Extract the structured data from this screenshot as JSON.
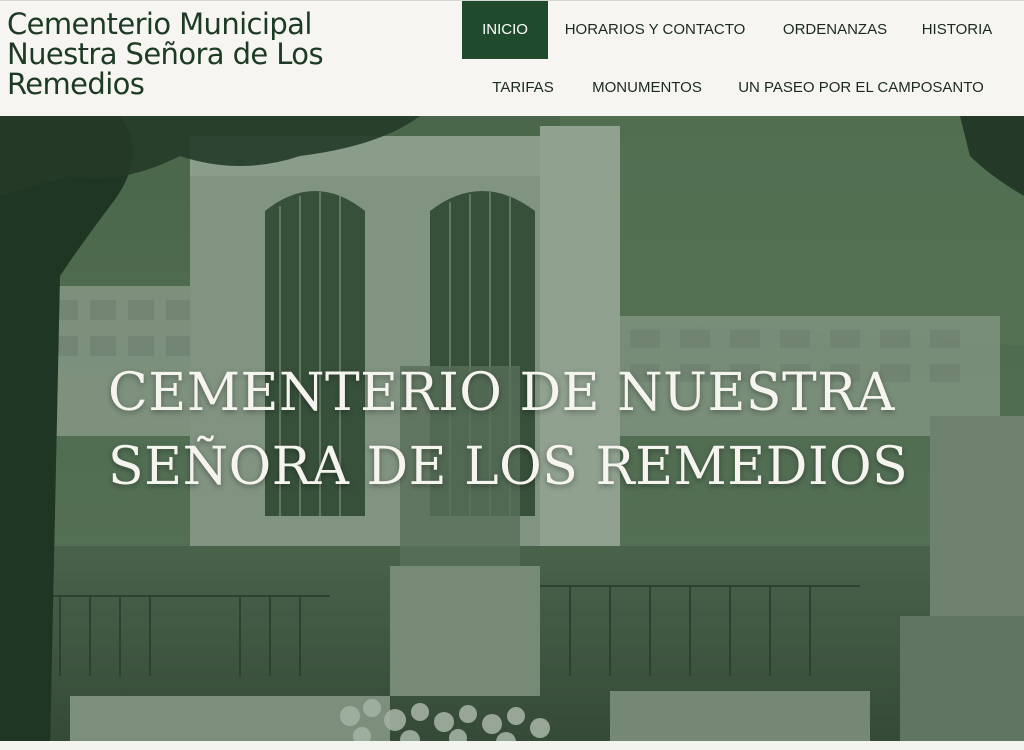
{
  "site": {
    "title": "Cementerio Municipal Nuestra Señora de Los Remedios"
  },
  "nav": {
    "items": [
      {
        "label": "INICIO",
        "active": true
      },
      {
        "label": "HORARIOS Y CONTACTO",
        "active": false
      },
      {
        "label": "ORDENANZAS",
        "active": false
      },
      {
        "label": "HISTORIA",
        "active": false
      },
      {
        "label": "TARIFAS",
        "active": false
      },
      {
        "label": "MONUMENTOS",
        "active": false
      },
      {
        "label": "UN PASEO POR EL CAMPOSANTO",
        "active": false
      }
    ]
  },
  "hero": {
    "heading": "CEMENTERIO DE NUESTRA SEÑORA DE LOS REMEDIOS",
    "image": "cemetery-photo"
  },
  "colors": {
    "brand_green": "#1f4a2c",
    "title_green": "#1d3b24",
    "header_bg": "#f6f5f2",
    "hero_text": "#f6f4ee"
  }
}
